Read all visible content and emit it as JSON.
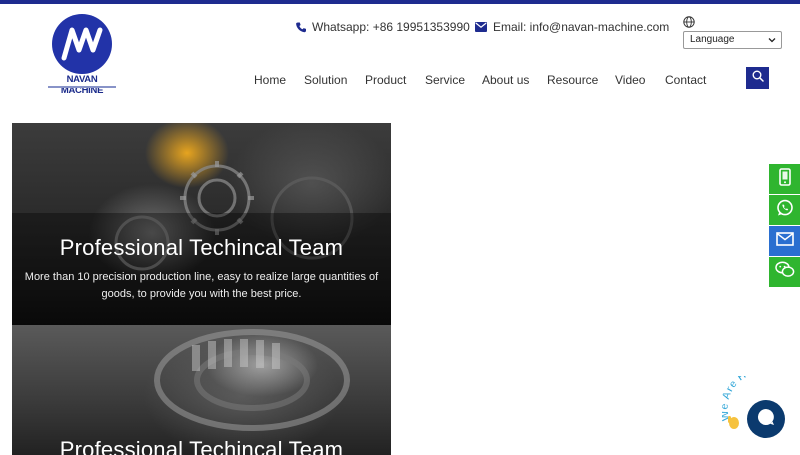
{
  "brand": {
    "name": "NAVAN MACHINE",
    "colors": {
      "primary": "#1e2b8f",
      "green": "#2fb52f",
      "blue": "#2a6fd0"
    }
  },
  "header": {
    "whatsapp_label": "Whatsapp: +86 19951353990",
    "email_label": "Email: info@navan-machine.com",
    "language": {
      "selected": "Language",
      "icon": "globe-icon"
    }
  },
  "nav": {
    "items": [
      {
        "label": "Home"
      },
      {
        "label": "Solution"
      },
      {
        "label": "Product"
      },
      {
        "label": "Service"
      },
      {
        "label": "About us"
      },
      {
        "label": "Resource"
      },
      {
        "label": "Video"
      },
      {
        "label": "Contact"
      }
    ],
    "search_icon": "search-icon"
  },
  "panels": [
    {
      "title": "Professional Techincal Team",
      "description": "More than 10 precision production line, easy to realize large quantities of goods, to provide you with the best price."
    },
    {
      "title": "Professional Techincal Team"
    }
  ],
  "side_buttons": [
    {
      "icon": "mobile-icon"
    },
    {
      "icon": "whatsapp-icon"
    },
    {
      "icon": "mail-icon"
    },
    {
      "icon": "wechat-icon"
    }
  ],
  "chat": {
    "badge_text": "We Are Here!",
    "icon": "chat-icon"
  }
}
